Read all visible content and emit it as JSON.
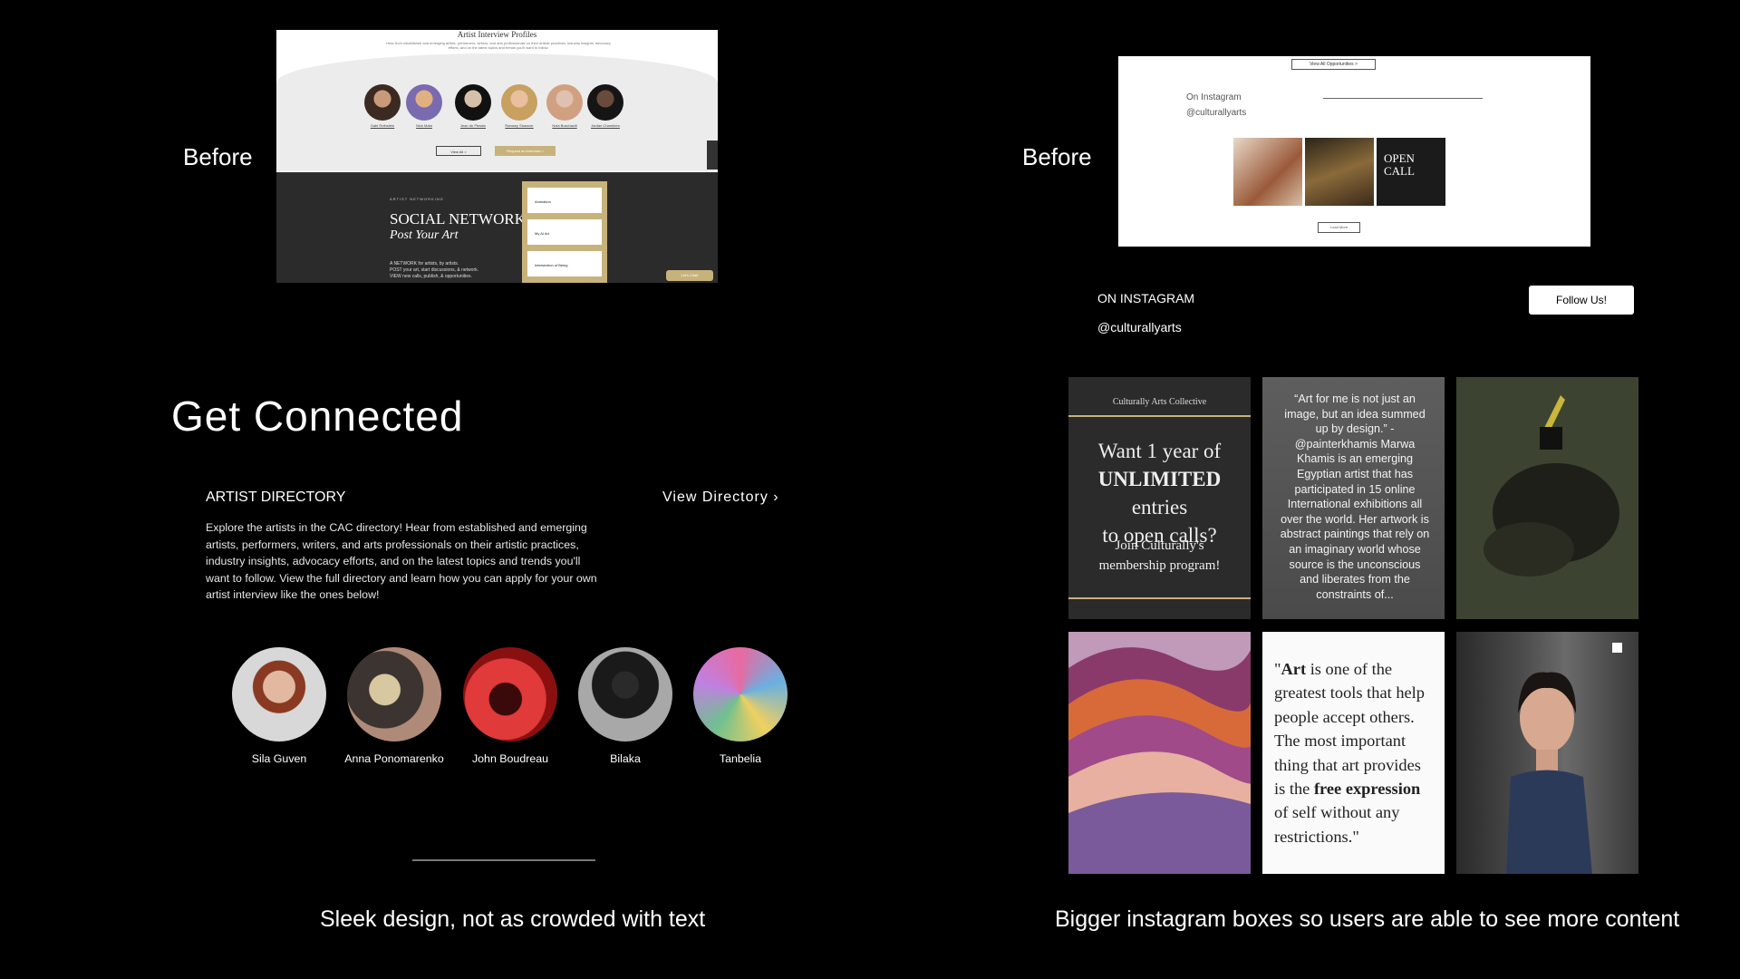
{
  "before_left_label": "Before",
  "before_right_label": "Before",
  "old_profiles": {
    "title": "Artist Interview Profiles",
    "subtitle": "Hear from established and emerging artists, performers, writers, and arts professionals on their artistic practices, industry insights, advocacy efforts, and on the latest topics and trends you'll want to follow.",
    "names": [
      "Gabi Rothstein",
      "Nick Mata",
      "Jean du Plessis",
      "Ramsey Shawver",
      "Nola Buschardt",
      "Jordan Chambers"
    ],
    "view_all": "View All >",
    "apply": "Request an interview >",
    "networking_kicker": "ARTIST NETWORKING",
    "social_title": "SOCIAL NETWORK:",
    "social_subtitle": "Post Your Art",
    "social_points": [
      "A NETWORK for artists, by artists.",
      "POST your art, start discussions, & network.",
      "VIEW new calls, publish, & opportunities."
    ],
    "cards": [
      "Animation",
      "My AI Art",
      "Intersection of Being"
    ],
    "chat": "Let's Chat!"
  },
  "old_instagram": {
    "view_all": "View All Opportunities >",
    "on_instagram": "On Instagram",
    "handle": "@culturallyarts",
    "tile_text": "OPEN CALL",
    "load_more": "Load More"
  },
  "get_connected": {
    "title": "Get Connected",
    "directory_heading": "ARTIST DIRECTORY",
    "directory_link": "View Directory",
    "directory_body": "Explore the artists in the CAC directory! Hear from established and emerging artists, performers, writers, and arts professionals on their artistic practices, industry insights, advocacy efforts, and on the latest topics and trends you'll want to follow. View the full directory and learn how you can apply for your own artist interview like the ones below!",
    "artists": [
      {
        "name": "Sila Guven",
        "color": "#8a7a72"
      },
      {
        "name": "Anna Ponomarenko",
        "color": "#3b3431"
      },
      {
        "name": "John Boudreau",
        "color": "#c8252a"
      },
      {
        "name": "Bilaka",
        "color": "#8f8f8f"
      },
      {
        "name": "Tanbelia",
        "color": "#7aa6c9"
      }
    ]
  },
  "instagram": {
    "heading": "ON INSTAGRAM",
    "handle": "@culturallyarts",
    "follow": "Follow Us!",
    "tile1": {
      "brand": "Culturally Arts Collective",
      "line1": "Want 1 year of",
      "line2_bold": "UNLIMITED",
      "line2_rest": " entries",
      "line3": "to open calls?",
      "small1": "Join Culturally's",
      "small2": "membership program!"
    },
    "tile2_quote": "“Art for me is not just an image, but an idea summed up by design.” - @painterkhamis Marwa Khamis is an emerging Egyptian artist that has participated in 15 online International exhibitions all over the world. Her artwork is abstract paintings that rely on an imaginary world whose source is the unconscious and liberates from the constraints of...",
    "tile5": {
      "open": "\"",
      "bold1": "Art",
      "t1": " is one of the",
      "t2": "greatest tools that help",
      "t3": "people accept others.",
      "t4": "The most important",
      "t5": "thing that art provides",
      "t6a": "is the ",
      "bold2": "free expression",
      "t7": "of self without any",
      "t8": "restrictions.\""
    }
  },
  "captions": {
    "left": "Sleek design, not as crowded with text",
    "right": "Bigger instagram boxes so users are able to see more content"
  }
}
